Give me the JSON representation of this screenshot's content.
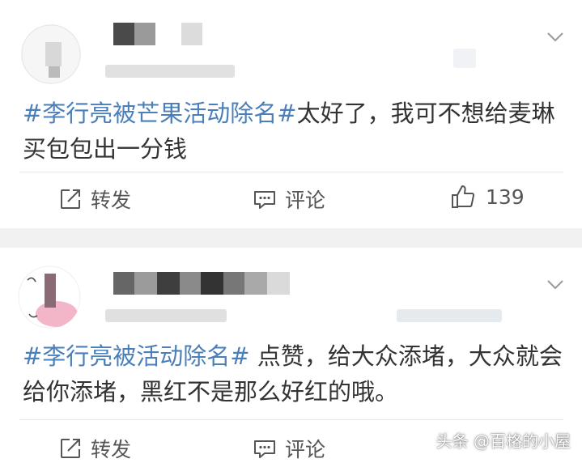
{
  "posts": [
    {
      "text_tag": "#李行亮被芒果活动除名#",
      "text_body": "太好了，我可不想给麦琳买包包出一分钱",
      "actions": {
        "repost": "转发",
        "comment": "评论",
        "likes": "139"
      }
    },
    {
      "text_tag": "#李行亮被活动除名#",
      "text_body": " 点赞，给大众添堵，大众就会给你添堵，黑红不是那么好红的哦。",
      "actions": {
        "repost": "转发",
        "comment": "评论",
        "likes": ""
      }
    }
  ],
  "watermark": "头条 @百格的小屋",
  "colors": {
    "hashtag": "#4a7fb9",
    "text": "#333333",
    "separator": "#f1f1f1"
  }
}
